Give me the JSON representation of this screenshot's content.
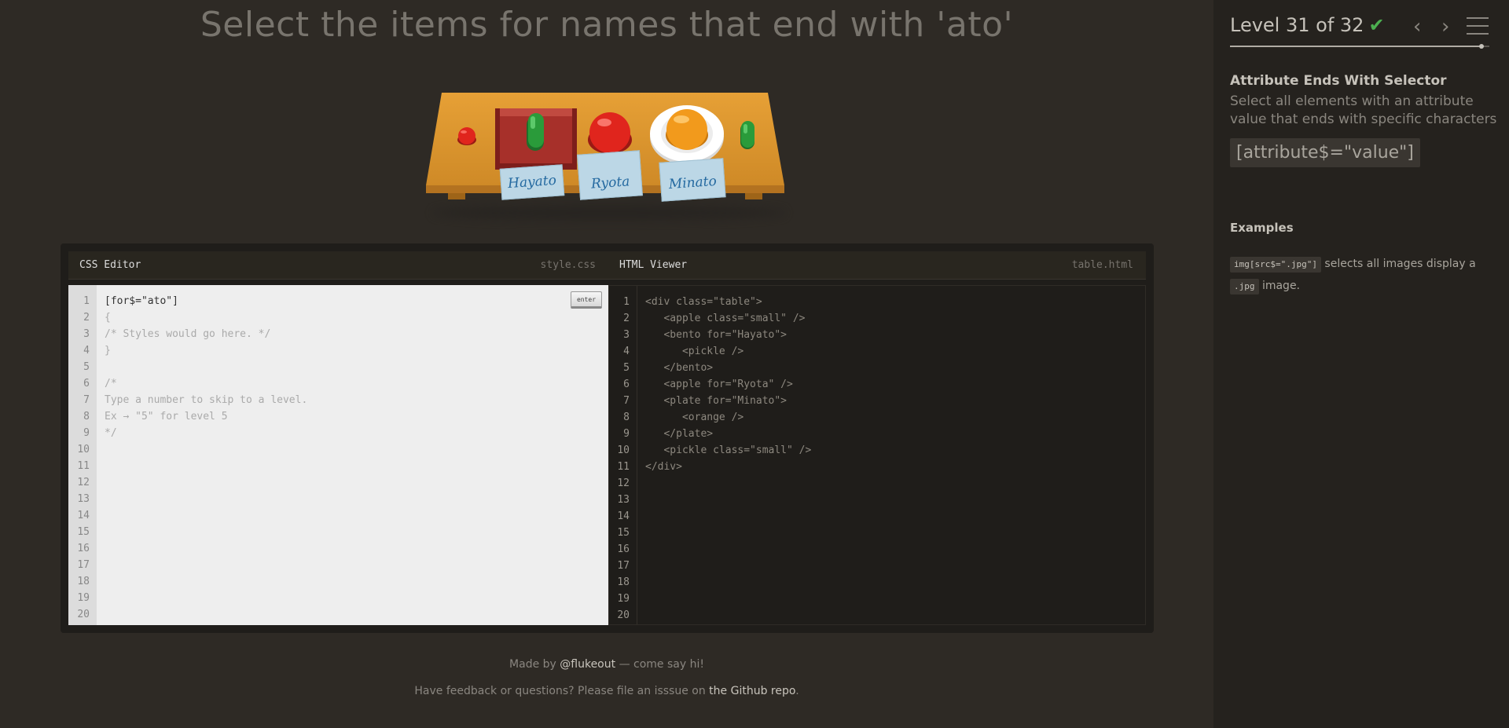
{
  "instruction": "Select the items for names that end with 'ato'",
  "scene": {
    "labels": [
      "Hayato",
      "Ryota",
      "Minato"
    ]
  },
  "css_editor": {
    "title": "CSS Editor",
    "filename": "style.css",
    "enter_label": "enter",
    "input_value": "[for$=\"ato\"]",
    "lines": [
      "{",
      "/* Styles would go here. */",
      "}",
      "",
      "/*",
      "Type a number to skip to a level.",
      "Ex → \"5\" for level 5",
      "*/"
    ],
    "line_numbers": [
      "1",
      "2",
      "3",
      "4",
      "5",
      "6",
      "7",
      "8",
      "9",
      "10",
      "11",
      "12",
      "13",
      "14",
      "15",
      "16",
      "17",
      "18",
      "19",
      "20"
    ]
  },
  "html_viewer": {
    "title": "HTML Viewer",
    "filename": "table.html",
    "lines": [
      "<div class=\"table\">",
      "   <apple class=\"small\" />",
      "   <bento for=\"Hayato\">",
      "      <pickle />",
      "   </bento>",
      "   <apple for=\"Ryota\" />",
      "   <plate for=\"Minato\">",
      "      <orange />",
      "   </plate>",
      "   <pickle class=\"small\" />",
      "</div>"
    ],
    "line_numbers": [
      "1",
      "2",
      "3",
      "4",
      "5",
      "6",
      "7",
      "8",
      "9",
      "10",
      "11",
      "12",
      "13",
      "14",
      "15",
      "16",
      "17",
      "18",
      "19",
      "20"
    ]
  },
  "footer": {
    "made_by_prefix": "Made by",
    "made_by_link": "@flukeout",
    "made_by_suffix": "— come say hi!",
    "feedback_prefix": "Have feedback or questions? Please file an isssue on",
    "feedback_link": "the Github repo",
    "feedback_suffix": "."
  },
  "sidebar": {
    "level_text": "Level 31 of 32",
    "check_icon": "✔",
    "prev_icon": "‹",
    "next_icon": "›",
    "progress_fraction": 0.97,
    "selector_name": "Attribute Ends With Selector",
    "selector_description": "Select all elements with an attribute value that ends with specific characters",
    "syntax": "[attribute$=\"value\"]",
    "examples_title": "Examples",
    "example_tag": "img[src$=\".jpg\"]",
    "example_text": "selects all images display a",
    "example_tag2": ".jpg",
    "example_text2": "image."
  },
  "colors": {
    "background": "#2e2a25",
    "sidebar": "#25221e",
    "table": "#d9902c",
    "apple": "#e0251d",
    "pickle": "#2a9b3a",
    "orange": "#f29a1c",
    "bento": "#9b2a26",
    "check": "#4caf50"
  }
}
